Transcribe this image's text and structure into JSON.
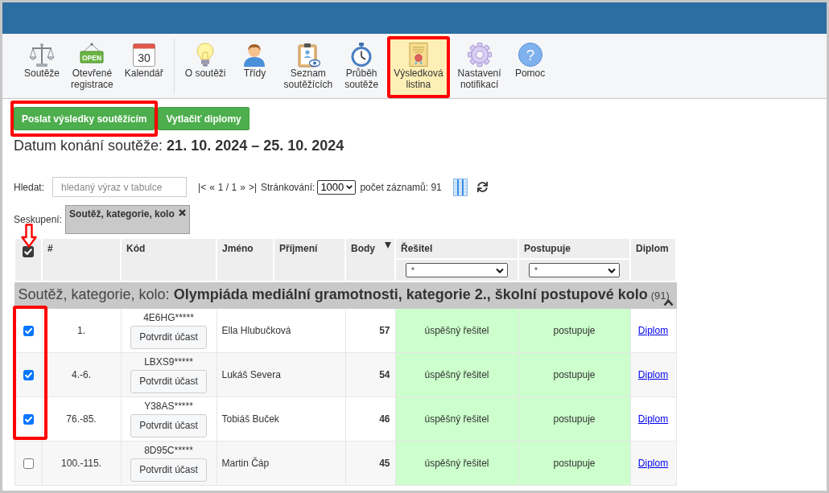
{
  "toolbar": {
    "groups": [
      {
        "items": [
          {
            "label": "Soutěže",
            "kind": "scales",
            "selected": false,
            "annotated": false
          },
          {
            "label": "Otevřené\nregistrace",
            "kind": "sign",
            "icon_text": "OPEN",
            "selected": false,
            "annotated": false
          },
          {
            "label": "Kalendář",
            "kind": "calendar",
            "icon_text": "30",
            "selected": false,
            "annotated": false
          }
        ]
      },
      {
        "items": [
          {
            "label": "O soutěži",
            "kind": "bulb",
            "selected": false,
            "annotated": false
          },
          {
            "label": "Třídy",
            "kind": "person",
            "selected": false,
            "annotated": false
          },
          {
            "label": "Seznam\nsoutěžících",
            "kind": "clipboard",
            "selected": false,
            "annotated": false
          },
          {
            "label": "Průběh\nsoutěže",
            "kind": "stopwatch",
            "selected": false,
            "annotated": false
          },
          {
            "label": "Výsledková\nlistina",
            "kind": "certificate",
            "selected": true,
            "annotated": true
          },
          {
            "label": "Nastavení\nnotifikací",
            "kind": "gear",
            "selected": false,
            "annotated": false
          },
          {
            "label": "Pomoc",
            "kind": "help",
            "icon_text": "?",
            "selected": false,
            "annotated": false
          }
        ]
      }
    ]
  },
  "actions": [
    {
      "label": "Poslat výsledky soutěžícím",
      "annotated": true
    },
    {
      "label": "Vytlačiť diplomy",
      "annotated": false
    }
  ],
  "date_line": "Datum konání soutěže: **21. 10. 2024 – 25. 10. 2024**",
  "search": {
    "label": "Hledat:",
    "placeholder": "hledaný výraz v tabulce"
  },
  "pager": {
    "first": "|<",
    "previous": "«",
    "page": "1 / 1",
    "next": "»",
    "last": ">|"
  },
  "page_size": {
    "label": "Stránkování:",
    "value": "1000"
  },
  "record_count": "počet záznamů: 91",
  "grouping": {
    "label": "Seskupení:",
    "chips": [
      {
        "label": "Soutěž, kategorie, kolo"
      }
    ]
  },
  "table": {
    "select_all": {
      "checked": true,
      "annotated": true
    },
    "columns": [
      {
        "label": "#",
        "sorted": false
      },
      {
        "label": "Kód",
        "sorted": false
      },
      {
        "label": "Jméno",
        "sorted": false
      },
      {
        "label": "Příjmení",
        "sorted": false
      },
      {
        "label": "Body",
        "sorted": true
      },
      {
        "label": "Řešitel",
        "sorted": false,
        "filter": "*"
      },
      {
        "label": "Postupuje",
        "sorted": false,
        "filter": "*"
      },
      {
        "label": "Diplom",
        "sorted": false
      }
    ],
    "group": {
      "title": "Soutěž, kategorie, kolo: **Olympiáda mediální gramotnosti, kategorie 2., školní postupové kolo**",
      "count": "(91)",
      "expanded": true
    },
    "rows": [
      {
        "checked": true,
        "annotated": true,
        "rank": "1.",
        "code": "4E6HG*****",
        "action": "Potvrdit účast",
        "name": "Ella Hlubučková",
        "points": "57",
        "kind": "success",
        "solver": "úspěšný řešitel",
        "advances": "postupuje",
        "link": "Diplom"
      },
      {
        "checked": true,
        "annotated": true,
        "rank": "4.-6.",
        "code": "LBXS9*****",
        "action": "Potvrdit účast",
        "name": "Lukáš Severa",
        "points": "54",
        "kind": "success",
        "solver": "úspěšný řešitel",
        "advances": "postupuje",
        "link": "Diplom"
      },
      {
        "checked": true,
        "annotated": true,
        "rank": "76.-85.",
        "code": "Y38AS*****",
        "action": "Potvrdit účast",
        "name": "Tobiáš Buček",
        "points": "46",
        "kind": "success",
        "solver": "úspěšný řešitel",
        "advances": "postupuje",
        "link": "Diplom"
      },
      {
        "checked": false,
        "annotated": false,
        "rank": "100.-115.",
        "code": "8D95C*****",
        "action": "Potvrdit účast",
        "name": "Martin Čáp",
        "points": "45",
        "kind": "success",
        "solver": "úspěšný řešitel",
        "advances": "postupuje",
        "link": "Diplom"
      }
    ]
  }
}
